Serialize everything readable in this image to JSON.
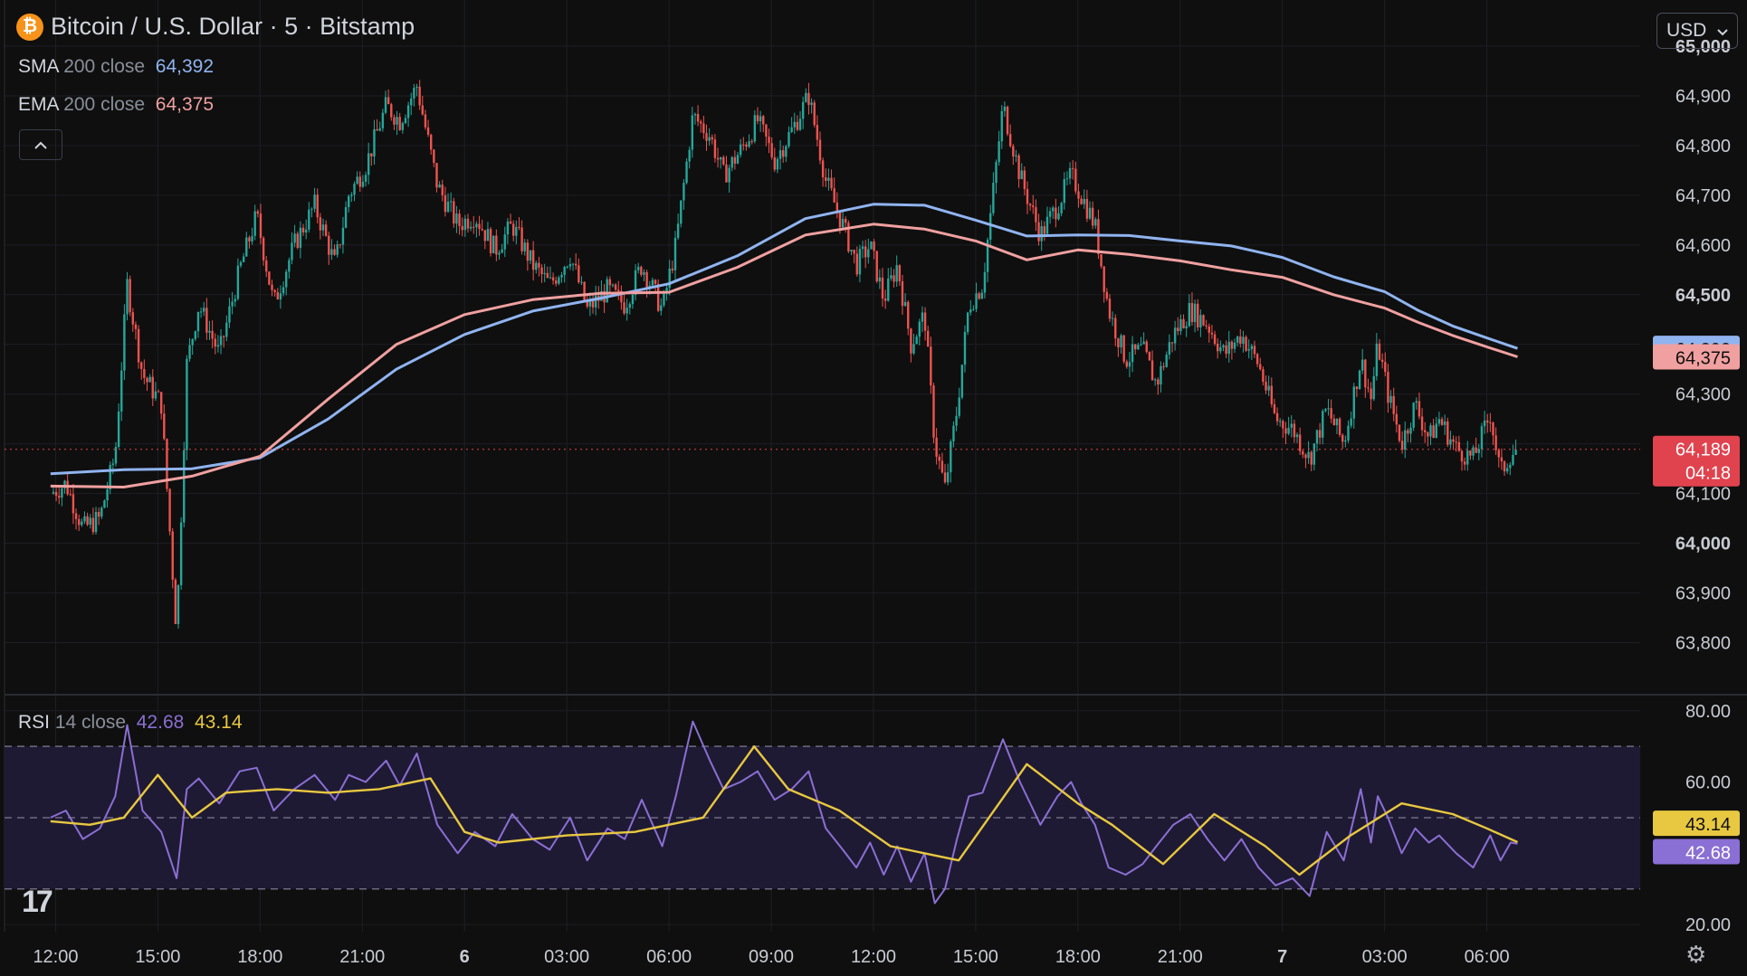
{
  "header": {
    "symbol_title": "Bitcoin / U.S. Dollar · 5 · Bitstamp",
    "symbol_badge": "₿",
    "currency_label": "USD",
    "currency_chevron": "⌄",
    "collapse_icon": "^"
  },
  "indicators": {
    "sma": {
      "name": "SMA",
      "params": "200 close",
      "value": "64,392",
      "color": "#90b4f0"
    },
    "ema": {
      "name": "EMA",
      "params": "200 close",
      "value": "64,375",
      "color": "#f0a0a0"
    },
    "rsi": {
      "name": "RSI",
      "params": "14 close",
      "value": "42.68",
      "ma_value": "43.14",
      "color": "#8a6fd4",
      "ma_color": "#e8c840"
    }
  },
  "price_badges": {
    "sma": "64,392",
    "ema": "64,375",
    "last": "64,189",
    "countdown": "04:18"
  },
  "colors": {
    "background": "#0f0f0f",
    "grid": "#1e1f24",
    "up": "#26a69a",
    "down": "#ef5350",
    "sma": "#90b4f0",
    "ema": "#f0a0a0",
    "rsi": "#8a6fd4",
    "rsi_ma": "#e8c840",
    "rsi_band": "#1f1a33",
    "last_price": "#e0434e"
  },
  "icons": {
    "logo": "tradingview-logo-icon",
    "settings": "gear-icon"
  },
  "tv_logo_text": "17",
  "settings_glyph": "⚙",
  "chart_data": [
    {
      "type": "candlestick",
      "title": "Bitcoin / U.S. Dollar · 5 · Bitstamp",
      "x_ticks": [
        "12:00",
        "15:00",
        "18:00",
        "21:00",
        "6",
        "03:00",
        "06:00",
        "09:00",
        "12:00",
        "15:00",
        "18:00",
        "21:00",
        "7",
        "03:00",
        "06:00"
      ],
      "x_ticks_bold": [
        "6",
        "7"
      ],
      "y_ticks": [
        "65,000",
        "64,900",
        "64,800",
        "64,700",
        "64,600",
        "64,500",
        "64,400",
        "64,300",
        "64,200",
        "64,100",
        "64,000",
        "63,900",
        "63,800"
      ],
      "y_ticks_bold": [
        "65,000",
        "64,500",
        "64,000"
      ],
      "y_tick_values": [
        65000,
        64900,
        64800,
        64700,
        64600,
        64500,
        64400,
        64300,
        64200,
        64100,
        64000,
        63900,
        63800
      ],
      "ylim": [
        63710,
        65020
      ],
      "grid": true,
      "close_path_time_hours": [
        11.85,
        12.3,
        12.8,
        13.3,
        13.75,
        14.1,
        14.55,
        15.1,
        15.55,
        15.85,
        16.2,
        16.8,
        17.4,
        17.9,
        18.4,
        19.0,
        19.6,
        20.2,
        20.6,
        21.1,
        21.7,
        22.1,
        22.6,
        23.2,
        23.8,
        24.3,
        24.9,
        25.4,
        26.0,
        26.5,
        27.1,
        27.6,
        28.2,
        28.7,
        29.2,
        29.8,
        30.2,
        30.7,
        31.2,
        31.6,
        32.1,
        32.6,
        33.1,
        33.6,
        34.1,
        34.6,
        35.1,
        35.5,
        35.9,
        36.3,
        36.7,
        37.1,
        37.5,
        37.8,
        38.1,
        38.45,
        38.8,
        39.2,
        39.8,
        40.3,
        40.9,
        41.4,
        41.8,
        42.1,
        42.5,
        42.9,
        43.4,
        43.9,
        44.3,
        44.8,
        45.3,
        45.8,
        46.3,
        46.8,
        47.3,
        47.8,
        48.3,
        48.8,
        49.3,
        49.8,
        50.3,
        50.6,
        50.8,
        51.1,
        51.5,
        51.9,
        52.3,
        52.6,
        53.1,
        53.6,
        54.1,
        54.4,
        54.7,
        54.9
      ],
      "close_path": [
        64100,
        64120,
        64030,
        64050,
        64180,
        64520,
        64340,
        64280,
        63820,
        64360,
        64480,
        64380,
        64550,
        64660,
        64480,
        64600,
        64680,
        64560,
        64700,
        64760,
        64880,
        64850,
        64920,
        64720,
        64640,
        64660,
        64590,
        64640,
        64560,
        64520,
        64580,
        64470,
        64510,
        64480,
        64560,
        64470,
        64600,
        64860,
        64820,
        64740,
        64790,
        64850,
        64770,
        64830,
        64900,
        64730,
        64640,
        64560,
        64600,
        64490,
        64560,
        64400,
        64460,
        64200,
        64110,
        64270,
        64480,
        64520,
        64880,
        64740,
        64620,
        64680,
        64740,
        64700,
        64640,
        64470,
        64370,
        64390,
        64320,
        64420,
        64470,
        64440,
        64380,
        64420,
        64360,
        64250,
        64230,
        64170,
        64270,
        64200,
        64370,
        64290,
        64400,
        64300,
        64200,
        64280,
        64210,
        64250,
        64190,
        64170,
        64260,
        64140,
        64180,
        64189
      ],
      "series": [
        {
          "name": "SMA 200 close",
          "x_hours": [
            11.85,
            14.0,
            16.0,
            18.0,
            20.0,
            22.0,
            24.0,
            26.0,
            28.0,
            30.0,
            32.0,
            34.0,
            36.0,
            37.5,
            39.0,
            40.5,
            42.0,
            43.5,
            45.0,
            46.5,
            48.0,
            49.5,
            51.0,
            52.0,
            53.0,
            54.0,
            54.9
          ],
          "values": [
            64140,
            64148,
            64150,
            64172,
            64250,
            64350,
            64420,
            64467,
            64493,
            64522,
            64578,
            64653,
            64682,
            64680,
            64650,
            64618,
            64620,
            64619,
            64608,
            64598,
            64575,
            64536,
            64506,
            64468,
            64437,
            64413,
            64392
          ]
        },
        {
          "name": "EMA 200 close",
          "x_hours": [
            11.85,
            14.0,
            16.0,
            18.0,
            20.0,
            22.0,
            24.0,
            26.0,
            28.0,
            30.0,
            32.0,
            34.0,
            36.0,
            37.5,
            39.0,
            40.5,
            42.0,
            43.5,
            45.0,
            46.5,
            48.0,
            49.5,
            51.0,
            52.0,
            53.0,
            54.0,
            54.9
          ],
          "values": [
            64115,
            64113,
            64135,
            64175,
            64290,
            64400,
            64460,
            64490,
            64503,
            64505,
            64555,
            64620,
            64642,
            64632,
            64608,
            64570,
            64590,
            64581,
            64568,
            64550,
            64535,
            64500,
            64473,
            64444,
            64418,
            64395,
            64375
          ]
        }
      ],
      "last_price": 64189,
      "countdown": "04:18"
    },
    {
      "type": "line",
      "title": "RSI 14 close",
      "y_ticks": [
        "80.00",
        "60.00",
        "20.00"
      ],
      "y_tick_values": [
        80,
        60,
        20
      ],
      "ylim": [
        18,
        84
      ],
      "band_levels": [
        70,
        50,
        30
      ],
      "grid": true,
      "series": [
        {
          "name": "RSI",
          "x_hours": [
            11.85,
            12.3,
            12.8,
            13.3,
            13.75,
            14.1,
            14.55,
            15.1,
            15.55,
            15.85,
            16.2,
            16.8,
            17.4,
            17.9,
            18.4,
            19.0,
            19.6,
            20.2,
            20.6,
            21.1,
            21.7,
            22.1,
            22.6,
            23.2,
            23.8,
            24.3,
            24.9,
            25.4,
            26.0,
            26.5,
            27.1,
            27.6,
            28.2,
            28.7,
            29.2,
            29.8,
            30.2,
            30.7,
            31.2,
            31.6,
            32.1,
            32.6,
            33.1,
            33.6,
            34.1,
            34.6,
            35.1,
            35.5,
            35.9,
            36.3,
            36.7,
            37.1,
            37.5,
            37.8,
            38.1,
            38.45,
            38.8,
            39.2,
            39.8,
            40.3,
            40.9,
            41.4,
            41.8,
            42.1,
            42.5,
            42.9,
            43.4,
            43.9,
            44.3,
            44.8,
            45.3,
            45.8,
            46.3,
            46.8,
            47.3,
            47.8,
            48.3,
            48.8,
            49.3,
            49.8,
            50.3,
            50.6,
            50.8,
            51.1,
            51.5,
            51.9,
            52.3,
            52.6,
            53.1,
            53.6,
            54.1,
            54.4,
            54.7,
            54.9
          ],
          "values": [
            50,
            52,
            44,
            47,
            56,
            76,
            52,
            46,
            33,
            58,
            61,
            54,
            63,
            64,
            52,
            58,
            62,
            55,
            62,
            60,
            66,
            59,
            68,
            48,
            40,
            46,
            42,
            51,
            44,
            41,
            50,
            38,
            47,
            44,
            55,
            42,
            56,
            77,
            66,
            58,
            60,
            63,
            55,
            58,
            63,
            47,
            41,
            36,
            43,
            34,
            42,
            32,
            40,
            26,
            30,
            44,
            56,
            57,
            72,
            60,
            48,
            56,
            60,
            54,
            48,
            36,
            34,
            37,
            42,
            48,
            51,
            44,
            38,
            44,
            36,
            31,
            33,
            28,
            46,
            38,
            58,
            43,
            56,
            50,
            40,
            47,
            43,
            45,
            40,
            36,
            45,
            38,
            43,
            42.68
          ]
        },
        {
          "name": "RSI-based MA",
          "x_hours": [
            11.85,
            13.0,
            14.0,
            15.0,
            16.0,
            17.0,
            18.5,
            20.0,
            21.5,
            23.0,
            24.0,
            25.0,
            27.0,
            29.0,
            31.0,
            32.5,
            33.5,
            35.0,
            36.5,
            38.5,
            40.5,
            42.0,
            43.0,
            44.5,
            46.0,
            47.5,
            48.5,
            50.0,
            51.5,
            53.0,
            54.0,
            54.9
          ],
          "values": [
            49,
            48,
            50,
            62,
            50,
            57,
            58,
            57,
            58,
            61,
            46,
            43,
            45,
            46,
            50,
            70,
            58,
            52,
            42,
            38,
            65,
            54,
            48,
            37,
            51,
            42,
            34,
            45,
            54,
            51,
            47,
            43.14
          ]
        }
      ],
      "last_value": 42.68,
      "last_ma_value": 43.14
    }
  ]
}
